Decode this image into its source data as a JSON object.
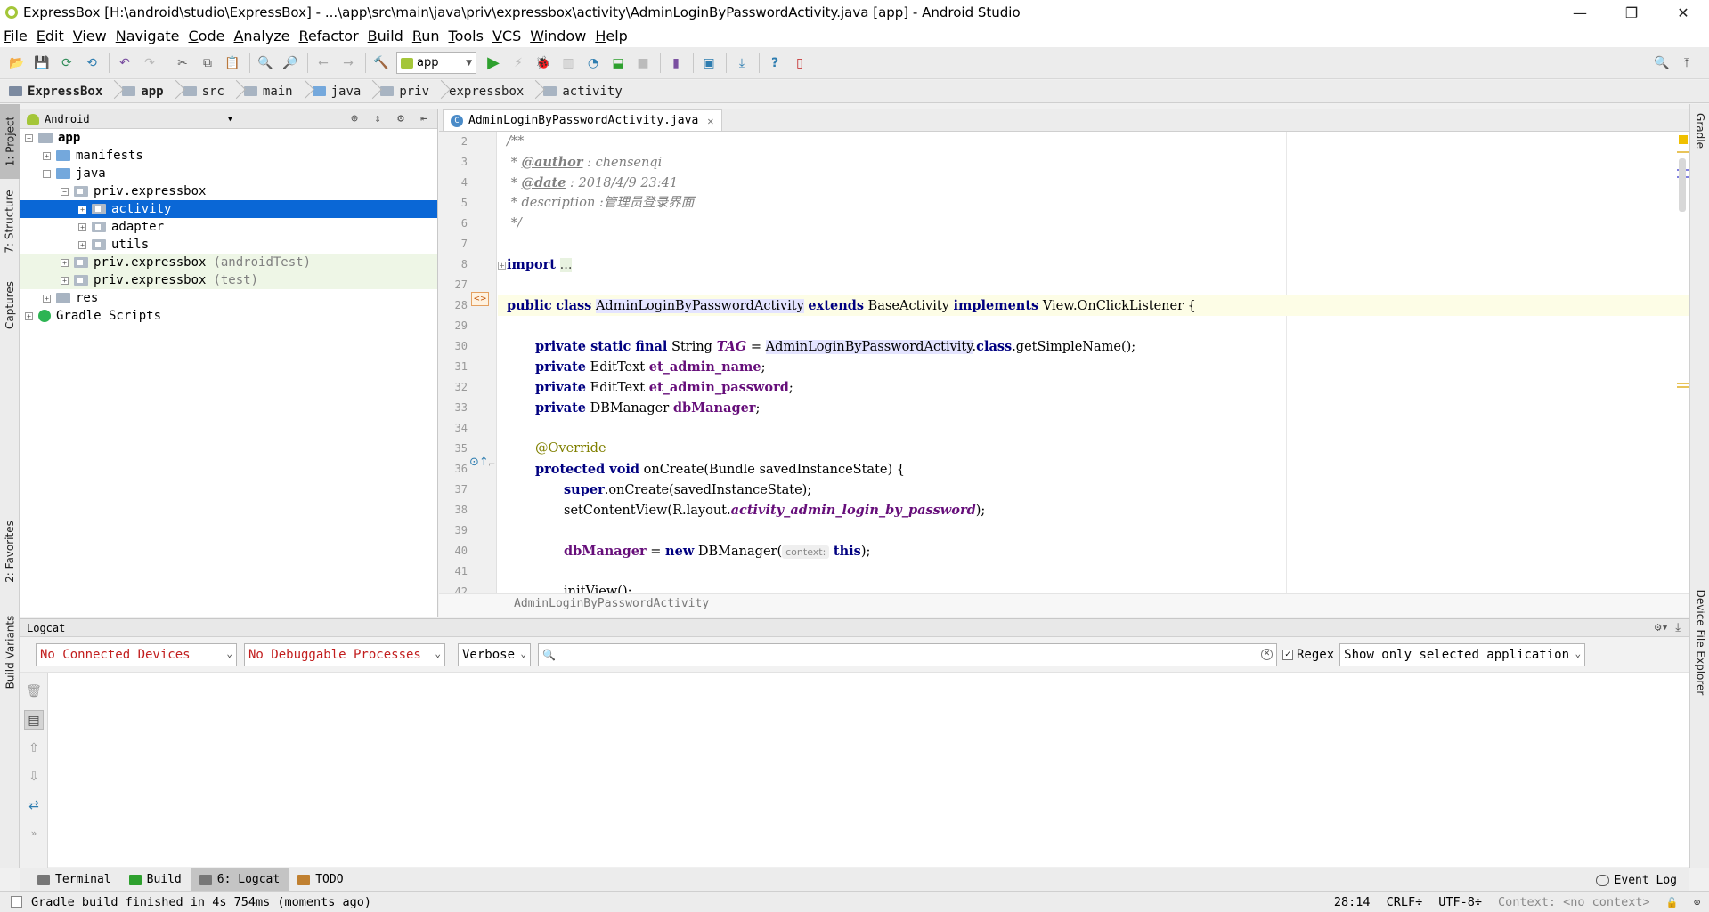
{
  "window": {
    "title": "ExpressBox [H:\\android\\studio\\ExpressBox] - ...\\app\\src\\main\\java\\priv\\expressbox\\activity\\AdminLoginByPasswordActivity.java [app] - Android Studio",
    "minimize": "—",
    "restore": "❐",
    "close": "✕"
  },
  "menu": [
    "File",
    "Edit",
    "View",
    "Navigate",
    "Code",
    "Analyze",
    "Refactor",
    "Build",
    "Run",
    "Tools",
    "VCS",
    "Window",
    "Help"
  ],
  "toolbar": {
    "run_config": "app"
  },
  "breadcrumb": [
    "ExpressBox",
    "app",
    "src",
    "main",
    "java",
    "priv",
    "expressbox",
    "activity"
  ],
  "left_tool_tabs": [
    "1: Project",
    "7: Structure",
    "Captures",
    "2: Favorites",
    "Build Variants"
  ],
  "right_tool_tabs": [
    "Gradle",
    "Device File Explorer"
  ],
  "project": {
    "view_mode": "Android",
    "tree": [
      {
        "label": "app",
        "suffix": "",
        "depth": 0
      },
      {
        "label": "manifests",
        "suffix": "",
        "depth": 1
      },
      {
        "label": "java",
        "suffix": "",
        "depth": 1
      },
      {
        "label": "priv.expressbox",
        "suffix": "",
        "depth": 2
      },
      {
        "label": "activity",
        "suffix": "",
        "depth": 3
      },
      {
        "label": "adapter",
        "suffix": "",
        "depth": 3
      },
      {
        "label": "utils",
        "suffix": "",
        "depth": 3
      },
      {
        "label": "priv.expressbox",
        "suffix": "(androidTest)",
        "depth": 2
      },
      {
        "label": "priv.expressbox",
        "suffix": "(test)",
        "depth": 2
      },
      {
        "label": "res",
        "suffix": "",
        "depth": 1
      },
      {
        "label": "Gradle Scripts",
        "suffix": "",
        "depth": 0
      }
    ]
  },
  "editor": {
    "tab_label": "AdminLoginByPasswordActivity.java",
    "tab_icon_letter": "C",
    "line_numbers": [
      "2",
      "3",
      "4",
      "5",
      "6",
      "7",
      "8",
      "27",
      "28",
      "29",
      "30",
      "31",
      "32",
      "33",
      "34",
      "35",
      "36",
      "37",
      "38",
      "39",
      "40",
      "41",
      "42"
    ],
    "code": {
      "l2": "/**",
      "l3_a": " * ",
      "l3_tag": "@author",
      "l3_b": " : chensenqi",
      "l4_a": " * ",
      "l4_tag": "@date",
      "l4_b": " : 2018/4/9 23:41",
      "l5": " * description :管理员登录界面",
      "l6": " */",
      "l8_kw": "import",
      "l8_dots": "...",
      "l28_kw1": "public",
      "l28_kw2": "class",
      "l28_cls": "AdminLoginByPasswordActivity",
      "l28_kw3": "extends",
      "l28_base": "BaseActivity",
      "l28_kw4": "implements",
      "l28_iface": "View.OnClickListener {",
      "l30_kw": "private static final",
      "l30_type": " String ",
      "l30_field": "TAG",
      "l30_eq": " = ",
      "l30_cls": "AdminLoginByPasswordActivity",
      "l30_dot": ".",
      "l30_kw2": "class",
      "l30_tail": ".getSimpleName();",
      "l31_kw": "private",
      "l31_type": " EditText ",
      "l31_field": "et_admin_name",
      "l31_end": ";",
      "l32_kw": "private",
      "l32_type": " EditText ",
      "l32_field": "et_admin_password",
      "l32_end": ";",
      "l33_kw": "private",
      "l33_type": " DBManager ",
      "l33_field": "dbManager",
      "l33_end": ";",
      "l35_ann": "@Override",
      "l36_kw": "protected void",
      "l36_rest": " onCreate(Bundle savedInstanceState) {",
      "l37_kw": "super",
      "l37_rest": ".onCreate(savedInstanceState);",
      "l38_a": "setContentView(R.layout.",
      "l38_field": "activity_admin_login_by_password",
      "l38_b": ");",
      "l40_field": "dbManager",
      "l40_eq": " = ",
      "l40_kw": "new",
      "l40_cls": " DBManager(",
      "l40_hint": "context:",
      "l40_kw2": "this",
      "l40_end": ");",
      "l42": "initView();"
    },
    "footer_breadcrumb": "AdminLoginByPasswordActivity"
  },
  "logcat": {
    "title": "Logcat",
    "device": "No Connected Devices",
    "process": "No Debuggable Processes",
    "level": "Verbose",
    "search_value": "",
    "regex_label": "Regex",
    "regex_checked": "✓",
    "filter": "Show only selected application",
    "header_icons": "⚙▾ ⤓"
  },
  "bottom_tabs": [
    {
      "label": "Terminal"
    },
    {
      "label": "Build"
    },
    {
      "label": "6: Logcat"
    },
    {
      "label": "TODO"
    }
  ],
  "event_log": "Event Log",
  "status": {
    "message": "Gradle build finished in 4s 754ms (moments ago)",
    "position": "28:14",
    "line_sep": "CRLF÷",
    "encoding": "UTF-8÷",
    "context": "Context: <no context>"
  },
  "colors": {
    "selection": "#0a67d6",
    "keyword": "#000080",
    "field": "#660e7a",
    "error_red": "#c21d1d"
  }
}
